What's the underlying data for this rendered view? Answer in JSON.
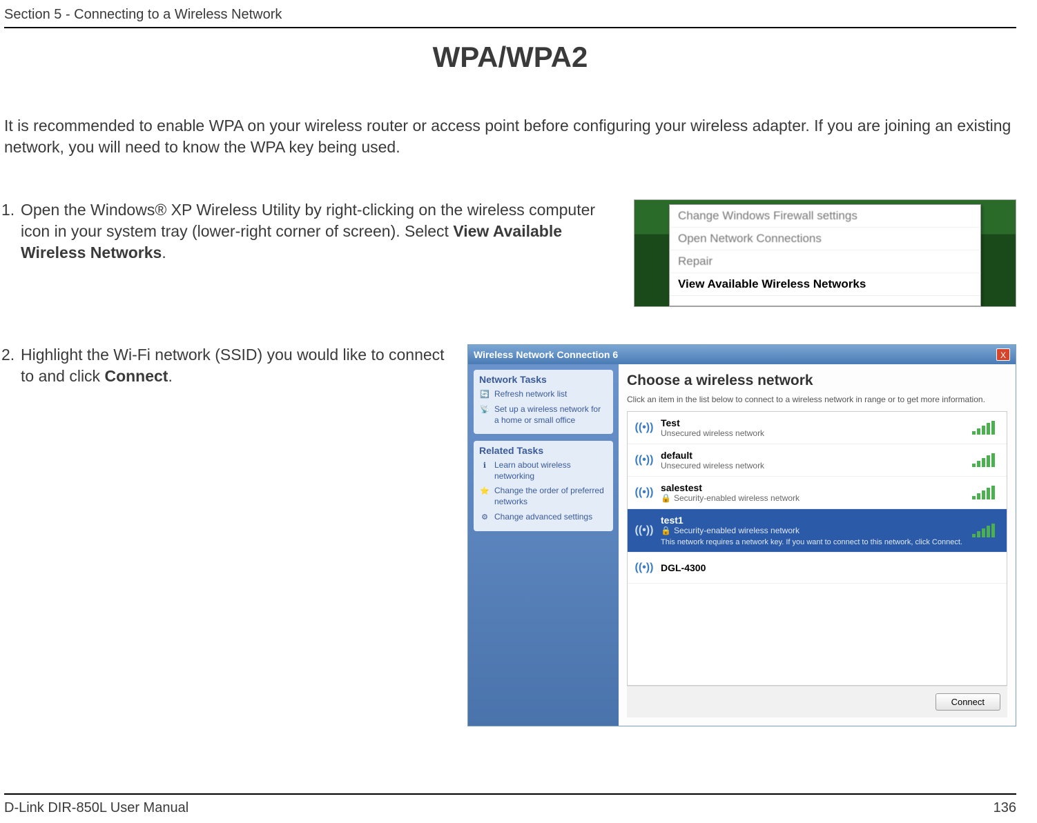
{
  "header": {
    "section": "Section 5 - Connecting to a Wireless Network"
  },
  "title": "WPA/WPA2",
  "intro": "It is recommended to enable WPA on your wireless router or access point before configuring your wireless adapter. If you are joining an existing network, you will need to know the WPA key being used.",
  "step1": {
    "num": "1.",
    "text_a": "Open the Windows® XP Wireless Utility by right-clicking on the wireless computer icon in your system tray (lower-right corner of screen). Select ",
    "bold": "View Available Wireless Networks",
    "text_b": "."
  },
  "step2": {
    "num": "2.",
    "text_a": "Highlight the Wi-Fi network (SSID) you would like to connect to and click ",
    "bold": "Connect",
    "text_b": "."
  },
  "ss1": {
    "items": [
      "Change Windows Firewall settings",
      "Open Network Connections",
      "Repair",
      "View Available Wireless Networks"
    ]
  },
  "ss2": {
    "titlebar": "Wireless Network Connection 6",
    "close": "X",
    "sidebar": {
      "panel1_title": "Network Tasks",
      "panel1_items": [
        "Refresh network list",
        "Set up a wireless network for a home or small office"
      ],
      "panel2_title": "Related Tasks",
      "panel2_items": [
        "Learn about wireless networking",
        "Change the order of preferred networks",
        "Change advanced settings"
      ]
    },
    "main": {
      "title": "Choose a wireless network",
      "sub": "Click an item in the list below to connect to a wireless network in range or to get more information.",
      "networks": [
        {
          "name": "Test",
          "desc": "Unsecured wireless network",
          "secure": false,
          "selected": false
        },
        {
          "name": "default",
          "desc": "Unsecured wireless network",
          "secure": false,
          "selected": false
        },
        {
          "name": "salestest",
          "desc": "Security-enabled wireless network",
          "secure": true,
          "selected": false
        },
        {
          "name": "test1",
          "desc": "Security-enabled wireless network",
          "secure": true,
          "selected": true,
          "extra": "This network requires a network key. If you want to connect to this network, click Connect."
        },
        {
          "name": "DGL-4300",
          "desc": "",
          "secure": false,
          "selected": false
        }
      ],
      "connect_btn": "Connect"
    }
  },
  "footer": {
    "left": "D-Link DIR-850L User Manual",
    "right": "136"
  }
}
